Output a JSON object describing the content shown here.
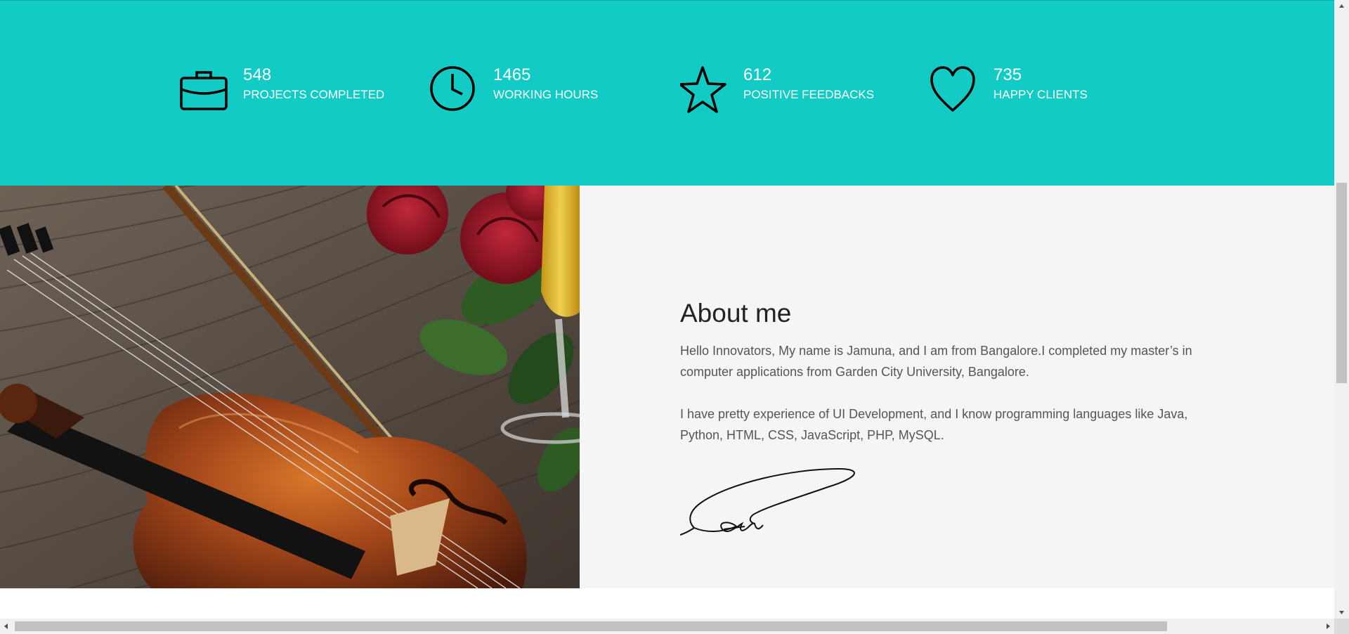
{
  "stats": [
    {
      "icon": "briefcase-icon",
      "value": "548",
      "label": "PROJECTS COMPLETED"
    },
    {
      "icon": "clock-icon",
      "value": "1465",
      "label": "WORKING HOURS"
    },
    {
      "icon": "star-icon",
      "value": "612",
      "label": "POSITIVE FEEDBACKS"
    },
    {
      "icon": "heart-icon",
      "value": "735",
      "label": "HAPPY CLIENTS"
    }
  ],
  "about": {
    "title": "About me",
    "paragraphs": [
      "Hello Innovators, My name is Jamuna, and I am from Bangalore.I completed my master’s in computer applications from Garden City University, Bangalore.",
      "I have pretty experience of UI Development, and I know programming languages like Java, Python, HTML, CSS, JavaScript, PHP, MySQL."
    ],
    "photo": "violin-and-roses-photo",
    "signature": "handwritten-signature"
  },
  "colors": {
    "stats_background": "#12cbc4",
    "stat_text": "#ffffff",
    "icon_stroke": "#000000",
    "about_background": "#f5f5f5",
    "heading": "#222222",
    "body_text": "#555555"
  }
}
